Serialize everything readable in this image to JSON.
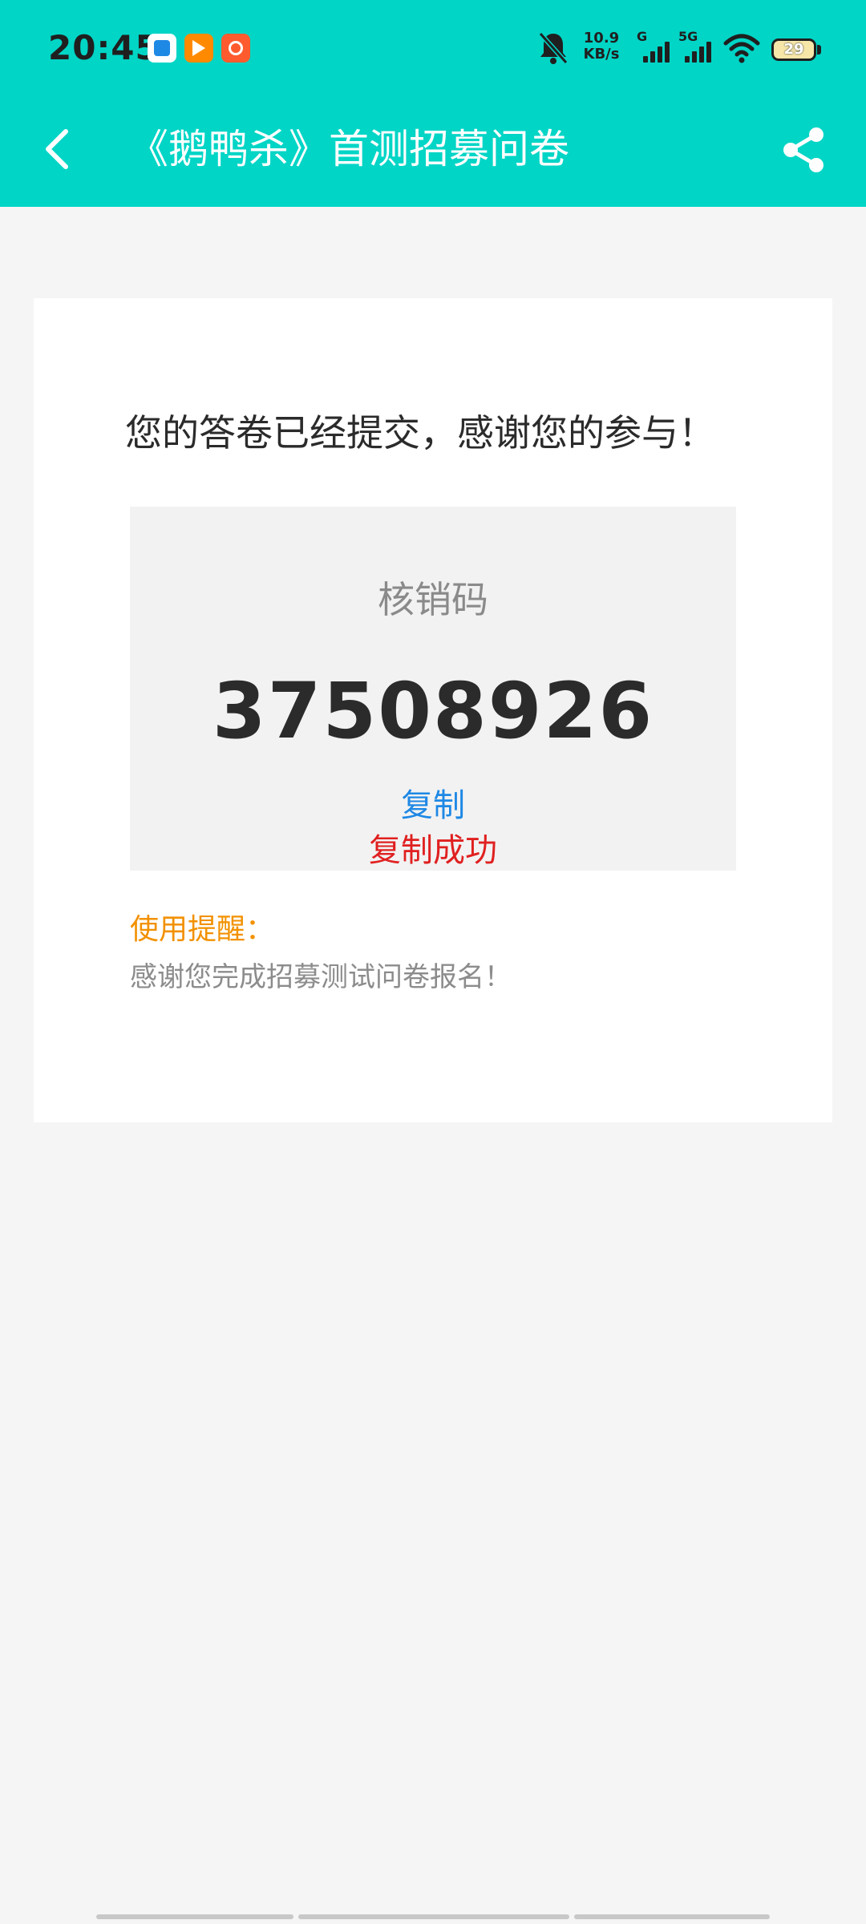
{
  "status_bar": {
    "time": "20:45",
    "net_speed_value": "10.9",
    "net_speed_unit": "KB/s",
    "signal1_tag": "G",
    "signal2_tag": "5G",
    "battery_level": "29",
    "icons": [
      "app-icon-1",
      "video-app-icon",
      "shop-app-icon",
      "mute-icon",
      "signal-icon",
      "wifi-icon",
      "battery-icon"
    ]
  },
  "header": {
    "title": "《鹅鸭杀》首测招募问卷",
    "back_icon": "back-arrow-icon",
    "share_icon": "share-icon",
    "background_color": "#00d5c6"
  },
  "main": {
    "thanks_text": "您的答卷已经提交，感谢您的参与！",
    "code_label": "核销码",
    "code_value": "37508926",
    "copy_label": "复制",
    "copy_success_label": "复制成功",
    "reminder_title": "使用提醒：",
    "reminder_text": "感谢您完成招募测试问卷报名！"
  },
  "colors": {
    "accent": "#00d5c6",
    "link": "#1e88e5",
    "success": "#e02020",
    "reminder": "#f29100"
  }
}
